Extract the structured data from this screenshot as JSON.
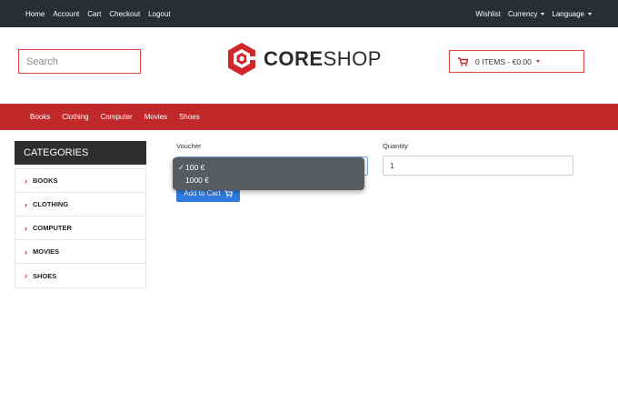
{
  "topbar": {
    "left_links": [
      "Home",
      "Account",
      "Cart",
      "Checkout",
      "Logout"
    ],
    "wishlist": "Wishlist",
    "currency": "Currency",
    "language": "Language"
  },
  "header": {
    "search_placeholder": "Search",
    "logo_core": "CORE",
    "logo_shop": "SHOP",
    "cart_label": "0 ITEMS - €0.00"
  },
  "nav": {
    "items": [
      "Books",
      "Clothing",
      "Computer",
      "Movies",
      "Shoes"
    ]
  },
  "sidebar": {
    "title": "CATEGORIES",
    "items": [
      "BOOKS",
      "CLOTHING",
      "COMPUTER",
      "MOVIES",
      "SHOES"
    ]
  },
  "product_form": {
    "voucher_label": "Voucher",
    "voucher_options": [
      {
        "label": "100 €",
        "selected": true
      },
      {
        "label": "1000 €",
        "selected": false
      }
    ],
    "quantity_label": "Quantity",
    "quantity_value": "1",
    "add_to_cart_label": "Add to Cart"
  },
  "colors": {
    "brand_red": "#c0282a",
    "topbar_bg": "#2a2d31",
    "button_blue": "#2f7be0"
  },
  "icons": [
    "cart-icon",
    "chevron-right-icon",
    "caret-down-icon",
    "check-icon",
    "coreshop-logo-icon"
  ]
}
